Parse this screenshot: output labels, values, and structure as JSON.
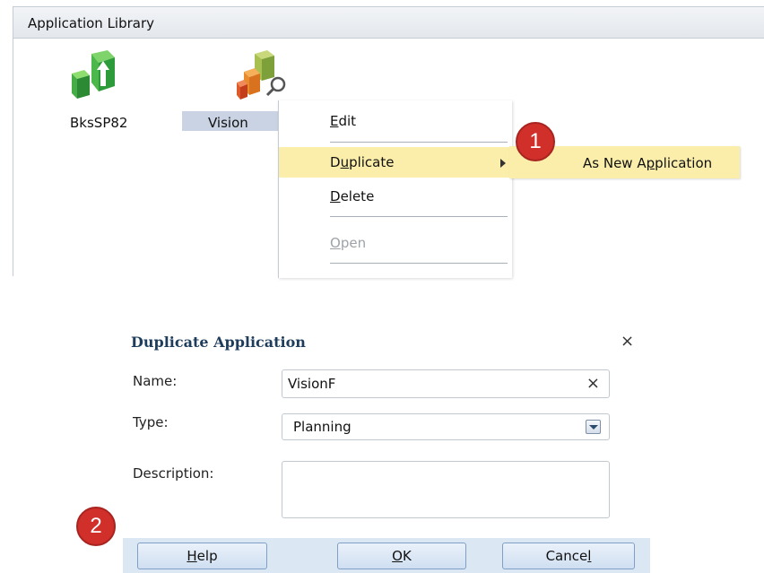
{
  "library": {
    "title": "Application Library",
    "apps": [
      {
        "name": "BksSP82",
        "icon": "green-cubes-icon"
      },
      {
        "name": "Vision",
        "icon": "orange-cubes-search-icon"
      }
    ]
  },
  "context_menu": {
    "items": [
      {
        "label": "Edit",
        "accel": "E",
        "rest": "dit",
        "state": "normal"
      },
      {
        "label": "Duplicate",
        "pre": "D",
        "accel": "u",
        "rest": "plicate",
        "state": "hover"
      },
      {
        "label": "Delete",
        "accel": "D",
        "rest": "elete",
        "state": "normal"
      },
      {
        "label": "Open",
        "accel": "O",
        "rest": "pen",
        "state": "disabled"
      }
    ],
    "submenu": {
      "label": "As New Application",
      "pre": "As New A",
      "accel": "p",
      "rest": "plication"
    }
  },
  "callouts": {
    "one": "1",
    "two": "2"
  },
  "dialog": {
    "title": "Duplicate Application",
    "close": "×",
    "name_label": "Name:",
    "name_value": "VisionF",
    "name_clear": "×",
    "type_label": "Type:",
    "type_value": "Planning",
    "description_label": "Description:",
    "description_value": "",
    "buttons": {
      "help": {
        "accel": "H",
        "rest": "elp"
      },
      "ok": {
        "accel": "O",
        "rest": "K"
      },
      "cancel": {
        "pre": "Cance",
        "accel": "l"
      }
    }
  },
  "colors": {
    "hover": "#fbeeab",
    "selection": "#c9d3e3",
    "callout": "#d12f2a",
    "dialog_footer": "#dce7f4",
    "title_text": "#1e3d5c"
  }
}
